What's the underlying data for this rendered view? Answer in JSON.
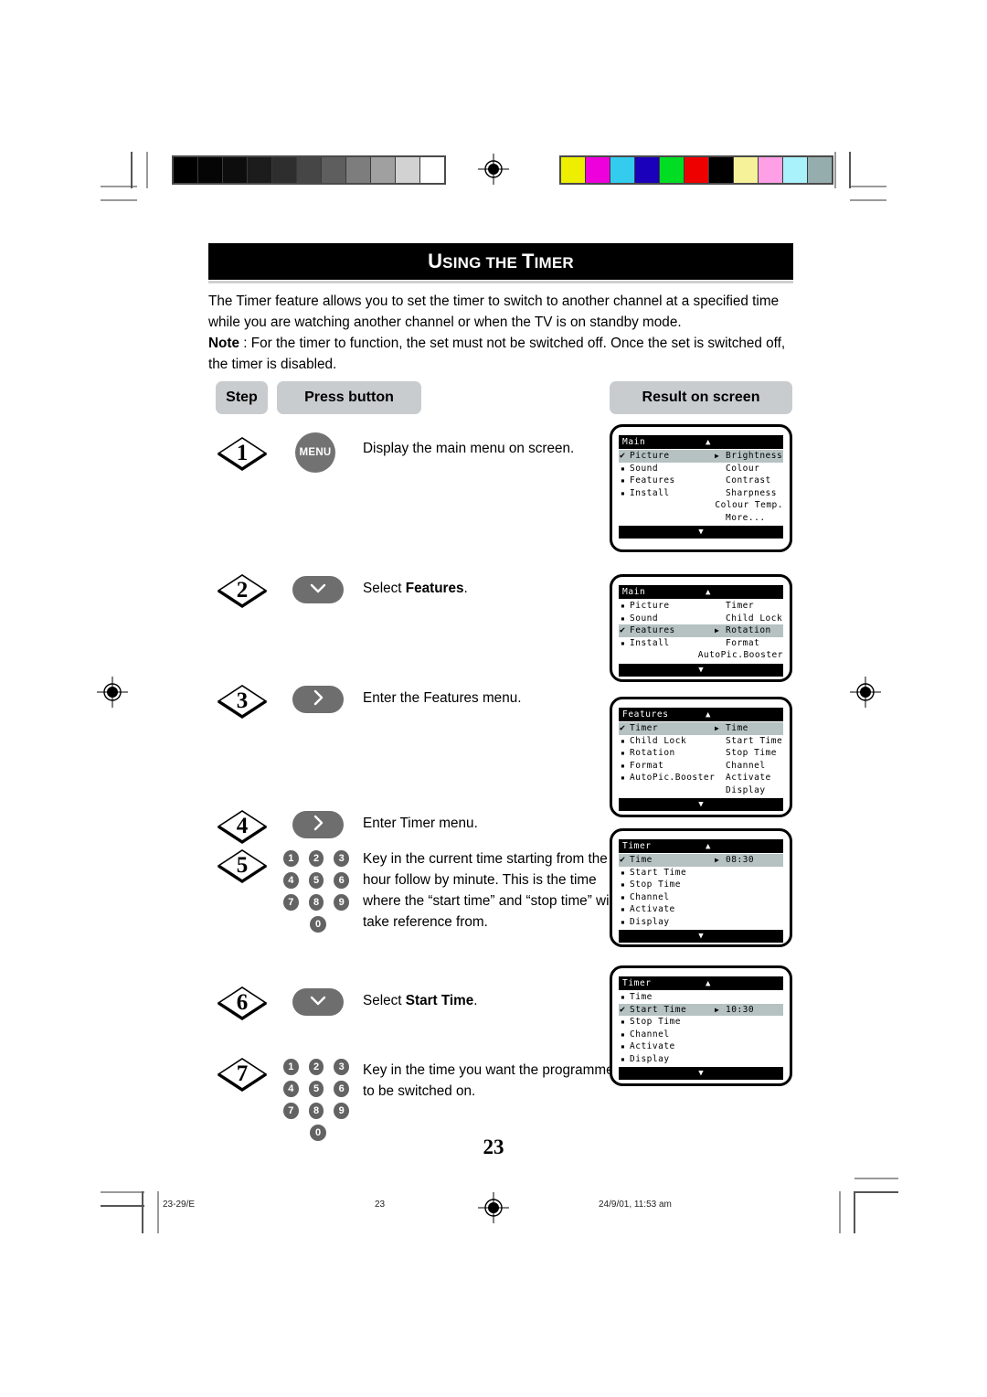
{
  "page": {
    "title_main": "U",
    "title": "USING THE TIMER",
    "title_parts": {
      "u": "U",
      "sing": "SING THE ",
      "t": "T",
      "imer": "IMER"
    },
    "page_number": "23"
  },
  "intro": {
    "para1": "The Timer feature allows you to set the timer to switch to another channel at a specified time while you are watching another channel or when the TV is on standby mode.",
    "note_label": "Note",
    "note_body": " : For the timer to function, the set must not be switched off. Once the set is switched off, the timer is disabled."
  },
  "table_headers": {
    "step": "Step",
    "press_button": "Press button",
    "result_on_screen": "Result on screen"
  },
  "steps": [
    {
      "num": "1",
      "button_kind": "menu",
      "button_label": "MENU",
      "text": "Display the main menu on screen."
    },
    {
      "num": "2",
      "button_kind": "down",
      "button_label": "⌄",
      "text_prefix": "Select ",
      "text_bold": "Features",
      "text_suffix": "."
    },
    {
      "num": "3",
      "button_kind": "right",
      "button_label": "›",
      "text": "Enter the Features menu."
    },
    {
      "num": "4",
      "button_kind": "right",
      "button_label": "›",
      "text": "Enter Timer menu."
    },
    {
      "num": "5",
      "button_kind": "keypad",
      "text": "Key in the current time starting from the hour follow by minute. This is the time where the “start time” and “stop time” will take reference from."
    },
    {
      "num": "6",
      "button_kind": "down",
      "button_label": "⌄",
      "text_prefix": "Select ",
      "text_bold": "Start Time",
      "text_suffix": "."
    },
    {
      "num": "7",
      "button_kind": "keypad",
      "text": "Key in the time you want the programme to be switched on."
    }
  ],
  "keypad_digits": [
    "1",
    "2",
    "3",
    "4",
    "5",
    "6",
    "7",
    "8",
    "9",
    "0"
  ],
  "osd_screens": [
    {
      "title": "Main",
      "up_arrow": "▲",
      "down_arrow": "▼",
      "rows": [
        {
          "mark": "check",
          "label": "Picture",
          "pointer": "▶",
          "right": "Brightness",
          "highlight": true
        },
        {
          "mark": "dot",
          "label": "Sound",
          "pointer": "",
          "right": "Colour",
          "highlight": false
        },
        {
          "mark": "dot",
          "label": "Features",
          "pointer": "",
          "right": "Contrast",
          "highlight": false
        },
        {
          "mark": "dot",
          "label": "Install",
          "pointer": "",
          "right": "Sharpness",
          "highlight": false
        },
        {
          "mark": "none",
          "label": "",
          "pointer": "",
          "right": "Colour Temp.",
          "highlight": false
        },
        {
          "mark": "none",
          "label": "",
          "pointer": "",
          "right": "More...",
          "highlight": false
        }
      ]
    },
    {
      "title": "Main",
      "up_arrow": "▲",
      "down_arrow": "▼",
      "rows": [
        {
          "mark": "dot",
          "label": "Picture",
          "pointer": "",
          "right": "Timer",
          "highlight": false
        },
        {
          "mark": "dot",
          "label": "Sound",
          "pointer": "",
          "right": "Child Lock",
          "highlight": false
        },
        {
          "mark": "check",
          "label": "Features",
          "pointer": "▶",
          "right": "Rotation",
          "highlight": true
        },
        {
          "mark": "dot",
          "label": "Install",
          "pointer": "",
          "right": "Format",
          "highlight": false
        },
        {
          "mark": "none",
          "label": "",
          "pointer": "",
          "right": "AutoPic.Booster",
          "highlight": false
        }
      ]
    },
    {
      "title": "Features",
      "up_arrow": "▲",
      "down_arrow": "▼",
      "rows": [
        {
          "mark": "check",
          "label": "Timer",
          "pointer": "▶",
          "right": "Time",
          "highlight": true
        },
        {
          "mark": "dot",
          "label": "Child Lock",
          "pointer": "",
          "right": "Start Time",
          "highlight": false
        },
        {
          "mark": "dot",
          "label": "Rotation",
          "pointer": "",
          "right": "Stop Time",
          "highlight": false
        },
        {
          "mark": "dot",
          "label": "Format",
          "pointer": "",
          "right": "Channel",
          "highlight": false
        },
        {
          "mark": "dot",
          "label": "AutoPic.Booster",
          "pointer": "",
          "right": "Activate",
          "highlight": false
        },
        {
          "mark": "none",
          "label": "",
          "pointer": "",
          "right": "Display",
          "highlight": false
        }
      ]
    },
    {
      "title": "Timer",
      "up_arrow": "▲",
      "down_arrow": "▼",
      "rows": [
        {
          "mark": "check",
          "label": "Time",
          "pointer": "▶",
          "right": "08:30",
          "highlight": true
        },
        {
          "mark": "dot",
          "label": "Start Time",
          "pointer": "",
          "right": "",
          "highlight": false
        },
        {
          "mark": "dot",
          "label": "Stop Time",
          "pointer": "",
          "right": "",
          "highlight": false
        },
        {
          "mark": "dot",
          "label": "Channel",
          "pointer": "",
          "right": "",
          "highlight": false
        },
        {
          "mark": "dot",
          "label": "Activate",
          "pointer": "",
          "right": "",
          "highlight": false
        },
        {
          "mark": "dot",
          "label": "Display",
          "pointer": "",
          "right": "",
          "highlight": false
        }
      ]
    },
    {
      "title": "Timer",
      "up_arrow": "▲",
      "down_arrow": "▼",
      "rows": [
        {
          "mark": "dot",
          "label": "Time",
          "pointer": "",
          "right": "",
          "highlight": false
        },
        {
          "mark": "check",
          "label": "Start Time",
          "pointer": "▶",
          "right": "10:30",
          "highlight": true
        },
        {
          "mark": "dot",
          "label": "Stop Time",
          "pointer": "",
          "right": "",
          "highlight": false
        },
        {
          "mark": "dot",
          "label": "Channel",
          "pointer": "",
          "right": "",
          "highlight": false
        },
        {
          "mark": "dot",
          "label": "Activate",
          "pointer": "",
          "right": "",
          "highlight": false
        },
        {
          "mark": "dot",
          "label": "Display",
          "pointer": "",
          "right": "",
          "highlight": false
        }
      ]
    }
  ],
  "footer": {
    "left": "23-29/E",
    "center": "23",
    "right": "24/9/01, 11:53 am"
  },
  "calibration": {
    "grayscale": [
      "#000000",
      "#050505",
      "#0d0d0d",
      "#1c1c1c",
      "#2e2e2e",
      "#464646",
      "#5e5e5e",
      "#7d7d7d",
      "#a0a0a0",
      "#d2d2d2",
      "#ffffff"
    ],
    "colors": [
      "#eeee00",
      "#ee00dd",
      "#33ccee",
      "#1a00bb",
      "#00dd22",
      "#ee0000",
      "#000000",
      "#f6f29a",
      "#ff9fe6",
      "#aaf2fb",
      "#96adad"
    ]
  }
}
